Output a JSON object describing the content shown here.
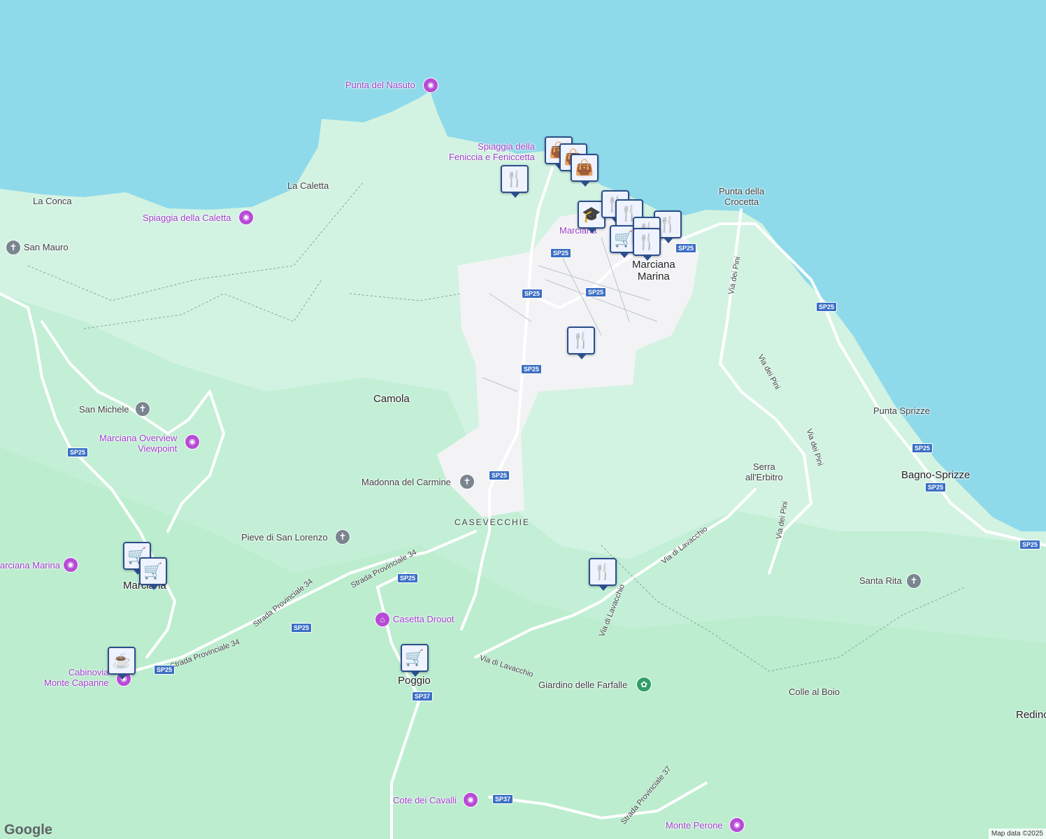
{
  "map": {
    "water_color": "#8fdaea",
    "land_color": "#d3f3e2",
    "forest_color": "#bfefd3",
    "urban_color": "#f3f3f3",
    "road_color": "#ffffff",
    "shield_color": "#3a6fc4"
  },
  "labels": {
    "punta_nasuto": "Punta del Nasuto",
    "spiaggia_feniccia": "Spiaggia della\nFeniccia e Feniccetta",
    "la_caletta": "La Caletta",
    "la_conca": "La Conca",
    "spiaggia_caletta": "Spiaggia della Caletta",
    "san_mauro": "San Mauro",
    "punta_crocetta": "Punta della\nCrocetta",
    "marciana_short": "Marciana",
    "marciana_marina": "Marciana\nMarina",
    "camola": "Camola",
    "san_michele": "San Michele",
    "marciana_overview": "Marciana Overview\nViewpoint",
    "punta_sprizze": "Punta Sprizze",
    "serra_erbitro": "Serra\nall'Erbitro",
    "bagno_sprizze": "Bagno-Sprizze",
    "madonna_carmine": "Madonna del Carmine",
    "casevecchie": "CASEVECCHIE",
    "pieve_lorenzo": "Pieve di San Lorenzo",
    "arciana_marina": "arciana Marina",
    "marciana_town": "Marciana",
    "santa_rita": "Santa Rita",
    "casetta_drouot": "Casetta Drouot",
    "cabinovia": "Cabinovia\nMonte Capanne",
    "poggio": "Poggio",
    "giardino_farfalle": "Giardino delle Farfalle",
    "colle_boio": "Colle al Boio",
    "redinc": "Redinc",
    "cote_cavalli": "Cote dei Cavalli",
    "monte_perone": "Monte Perone"
  },
  "roads": {
    "via_pini": "Via dei Pini",
    "via_lavacchio": "Via di Lavacchio",
    "strada_34": "Strada Provinciale 34",
    "strada_37": "Strada Provinciale 37",
    "sp25": "SP25",
    "sp37": "SP37"
  },
  "markers": [
    {
      "type": "shopping-bag"
    },
    {
      "type": "shopping-bag"
    },
    {
      "type": "shopping-bag"
    },
    {
      "type": "restaurant"
    },
    {
      "type": "school"
    },
    {
      "type": "restaurant"
    },
    {
      "type": "restaurant"
    },
    {
      "type": "restaurant"
    },
    {
      "type": "shopping-cart"
    },
    {
      "type": "restaurant"
    },
    {
      "type": "restaurant"
    },
    {
      "type": "shopping-cart"
    },
    {
      "type": "shopping-cart"
    },
    {
      "type": "cafe"
    },
    {
      "type": "shopping-cart"
    },
    {
      "type": "restaurant"
    }
  ],
  "footer": {
    "logo": "Google",
    "attribution": "Map data ©2025"
  }
}
